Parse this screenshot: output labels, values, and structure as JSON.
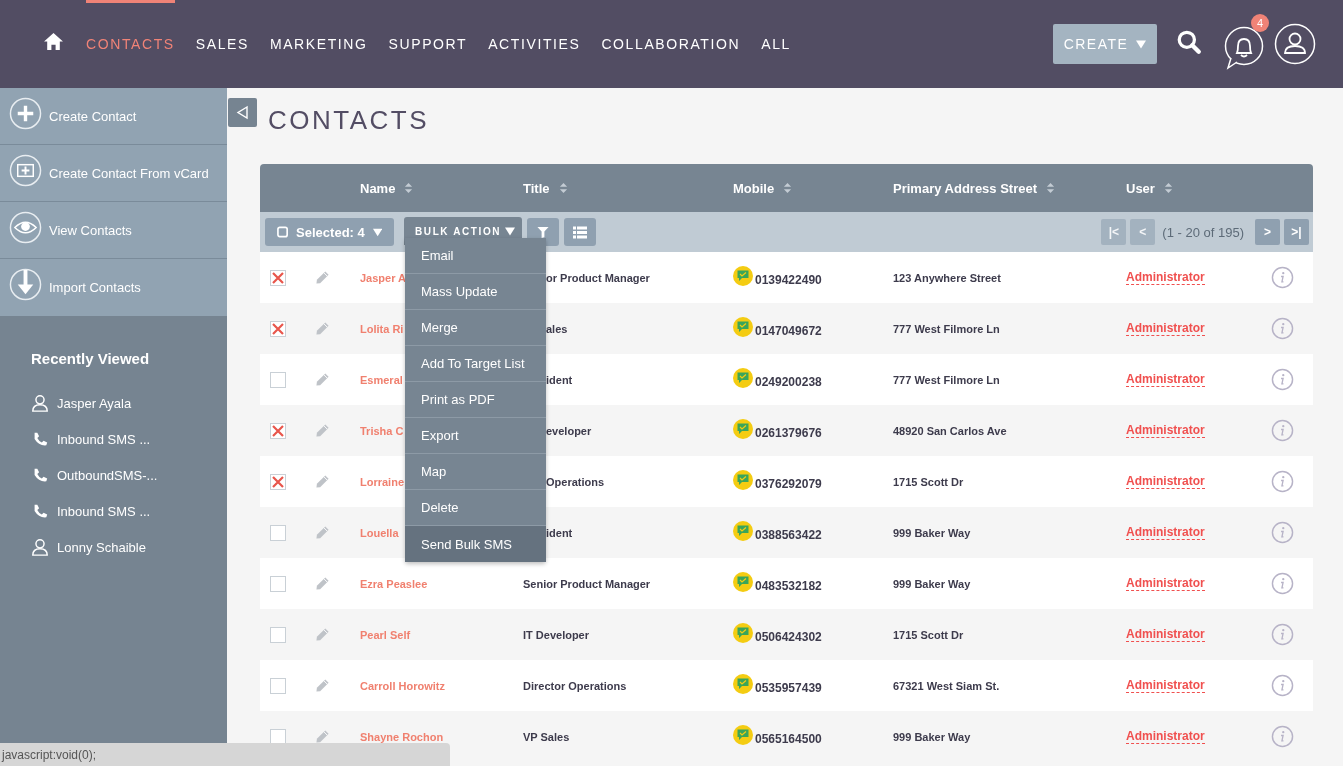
{
  "nav": {
    "items": [
      {
        "label": "CONTACTS",
        "selected": true
      },
      {
        "label": "SALES",
        "selected": false
      },
      {
        "label": "MARKETING",
        "selected": false
      },
      {
        "label": "SUPPORT",
        "selected": false
      },
      {
        "label": "ACTIVITIES",
        "selected": false
      },
      {
        "label": "COLLABORATION",
        "selected": false
      },
      {
        "label": "ALL",
        "selected": false
      }
    ],
    "create_button": "CREATE",
    "notification_count": "4"
  },
  "sidebar": {
    "actions": [
      {
        "label": "Create Contact",
        "kind": "plus"
      },
      {
        "label": "Create Contact From vCard",
        "kind": "card"
      },
      {
        "label": "View Contacts",
        "kind": "eye"
      },
      {
        "label": "Import Contacts",
        "kind": "import"
      }
    ],
    "recently_viewed": {
      "title": "Recently Viewed",
      "items": [
        {
          "label": "Jasper Ayala",
          "kind": "person"
        },
        {
          "label": "Inbound SMS ...",
          "kind": "phone"
        },
        {
          "label": "OutboundSMS-...",
          "kind": "phone"
        },
        {
          "label": "Inbound SMS ...",
          "kind": "phone"
        },
        {
          "label": "Lonny Schaible",
          "kind": "person"
        }
      ]
    }
  },
  "page_title": "CONTACTS",
  "table": {
    "columns": [
      "Name",
      "Title",
      "Mobile",
      "Primary Address Street",
      "User"
    ],
    "toolbar": {
      "selected_label": "Selected: 4",
      "bulk_action": "BULK ACTION",
      "pagination": "(1 - 20 of 195)",
      "page_buttons": [
        {
          "symbol": "|<",
          "disabled": true
        },
        {
          "symbol": "<",
          "disabled": true
        },
        {
          "symbol": ">",
          "disabled": false
        },
        {
          "symbol": ">|",
          "disabled": false
        }
      ]
    },
    "bulk_menu": {
      "items": [
        {
          "label": "Email",
          "selected": false
        },
        {
          "label": "Mass Update",
          "selected": false
        },
        {
          "label": "Merge",
          "selected": false
        },
        {
          "label": "Add To Target List",
          "selected": false
        },
        {
          "label": "Print as PDF",
          "selected": false
        },
        {
          "label": "Export",
          "selected": false
        },
        {
          "label": "Map",
          "selected": false
        },
        {
          "label": "Delete",
          "selected": false
        },
        {
          "label": "Send Bulk SMS",
          "selected": true
        }
      ]
    },
    "rows": [
      {
        "checked": true,
        "name": "Jasper A",
        "title": "or Product Manager",
        "mobile": "0139422490",
        "address": "123 Anywhere Street",
        "user": "Administrator"
      },
      {
        "checked": true,
        "name": "Lolita Ri",
        "title": "ales",
        "mobile": "0147049672",
        "address": "777 West Filmore Ln",
        "user": "Administrator"
      },
      {
        "checked": false,
        "name": "Esmeral",
        "title": "ident",
        "mobile": "0249200238",
        "address": "777 West Filmore Ln",
        "user": "Administrator"
      },
      {
        "checked": true,
        "name": "Trisha C",
        "title": "eveloper",
        "mobile": "0261379676",
        "address": "48920 San Carlos Ave",
        "user": "Administrator"
      },
      {
        "checked": true,
        "name": "Lorraine",
        "title": "Operations",
        "mobile": "0376292079",
        "address": "1715 Scott Dr",
        "user": "Administrator"
      },
      {
        "checked": false,
        "name": "Louella",
        "title": "ident",
        "mobile": "0388563422",
        "address": "999 Baker Way",
        "user": "Administrator"
      },
      {
        "checked": false,
        "name": "Ezra Peaslee",
        "title": "Senior Product Manager",
        "mobile": "0483532182",
        "address": "999 Baker Way",
        "user": "Administrator"
      },
      {
        "checked": false,
        "name": "Pearl Self",
        "title": "IT Developer",
        "mobile": "0506424302",
        "address": "1715 Scott Dr",
        "user": "Administrator"
      },
      {
        "checked": false,
        "name": "Carroll Horowitz",
        "title": "Director Operations",
        "mobile": "0535957439",
        "address": "67321 West Siam St.",
        "user": "Administrator"
      },
      {
        "checked": false,
        "name": "Shayne Rochon",
        "title": "VP Sales",
        "mobile": "0565164500",
        "address": "999 Baker Way",
        "user": "Administrator"
      }
    ]
  },
  "status_bar": "javascript:void(0);"
}
